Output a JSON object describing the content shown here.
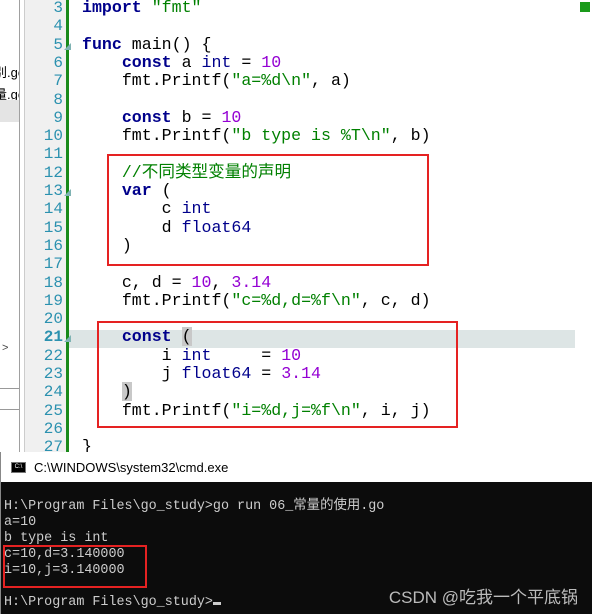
{
  "sidebar": {
    "files": [
      "别.go",
      "量.go"
    ]
  },
  "editor": {
    "current_line": 21,
    "lines": [
      {
        "n": 3,
        "tokens": [
          [
            "kw",
            "import"
          ],
          [
            "",
            ""
          ],
          [
            "str",
            " \"fmt\""
          ]
        ]
      },
      {
        "n": 4,
        "tokens": []
      },
      {
        "n": 5,
        "fold": true,
        "tokens": [
          [
            "kw",
            "func"
          ],
          [
            "",
            " main() {"
          ]
        ]
      },
      {
        "n": 6,
        "tokens": [
          [
            "",
            "    "
          ],
          [
            "kw",
            "const"
          ],
          [
            "",
            " a "
          ],
          [
            "ty",
            "int"
          ],
          [
            "",
            " = "
          ],
          [
            "num",
            "10"
          ]
        ]
      },
      {
        "n": 7,
        "tokens": [
          [
            "",
            "    fmt.Printf("
          ],
          [
            "str",
            "\"a=%d\\n\""
          ],
          [
            "",
            ", a)"
          ]
        ]
      },
      {
        "n": 8,
        "tokens": []
      },
      {
        "n": 9,
        "tokens": [
          [
            "",
            "    "
          ],
          [
            "kw",
            "const"
          ],
          [
            "",
            " b = "
          ],
          [
            "num",
            "10"
          ]
        ]
      },
      {
        "n": 10,
        "tokens": [
          [
            "",
            "    fmt.Printf("
          ],
          [
            "str",
            "\"b type is %T\\n\""
          ],
          [
            "",
            ", b)"
          ]
        ]
      },
      {
        "n": 11,
        "tokens": []
      },
      {
        "n": 12,
        "tokens": [
          [
            "",
            "    "
          ],
          [
            "cmt",
            "//不同类型变量的声明"
          ]
        ]
      },
      {
        "n": 13,
        "fold": true,
        "tokens": [
          [
            "",
            "    "
          ],
          [
            "kw",
            "var"
          ],
          [
            "",
            " ("
          ]
        ]
      },
      {
        "n": 14,
        "tokens": [
          [
            "",
            "        c "
          ],
          [
            "ty",
            "int"
          ]
        ]
      },
      {
        "n": 15,
        "tokens": [
          [
            "",
            "        d "
          ],
          [
            "ty",
            "float64"
          ]
        ]
      },
      {
        "n": 16,
        "tokens": [
          [
            "",
            "    )"
          ]
        ]
      },
      {
        "n": 17,
        "tokens": []
      },
      {
        "n": 18,
        "tokens": [
          [
            "",
            "    c, d = "
          ],
          [
            "num",
            "10"
          ],
          [
            "",
            ", "
          ],
          [
            "num",
            "3.14"
          ]
        ]
      },
      {
        "n": 19,
        "tokens": [
          [
            "",
            "    fmt.Printf("
          ],
          [
            "str",
            "\"c=%d,d=%f\\n\""
          ],
          [
            "",
            ", c, d)"
          ]
        ]
      },
      {
        "n": 20,
        "tokens": []
      },
      {
        "n": 21,
        "fold": true,
        "tokens": [
          [
            "",
            "    "
          ],
          [
            "kw",
            "const"
          ],
          [
            "",
            " "
          ],
          [
            "br",
            "("
          ]
        ]
      },
      {
        "n": 22,
        "tokens": [
          [
            "",
            "        i "
          ],
          [
            "ty",
            "int"
          ],
          [
            "",
            "     = "
          ],
          [
            "num",
            "10"
          ]
        ]
      },
      {
        "n": 23,
        "tokens": [
          [
            "",
            "        j "
          ],
          [
            "ty",
            "float64"
          ],
          [
            "",
            " = "
          ],
          [
            "num",
            "3.14"
          ]
        ]
      },
      {
        "n": 24,
        "tokens": [
          [
            "",
            "    "
          ],
          [
            "br",
            ")"
          ]
        ]
      },
      {
        "n": 25,
        "tokens": [
          [
            "",
            "    fmt.Printf("
          ],
          [
            "str",
            "\"i=%d,j=%f\\n\""
          ],
          [
            "",
            ", i, j)"
          ]
        ]
      },
      {
        "n": 26,
        "tokens": []
      },
      {
        "n": 27,
        "tokens": [
          [
            "",
            "}"
          ]
        ]
      }
    ]
  },
  "terminal": {
    "title": "C:\\WINDOWS\\system32\\cmd.exe",
    "icon": "C:\\",
    "lines": [
      "H:\\Program Files\\go_study>go run 06_常量的使用.go",
      "a=10",
      "b type is int",
      "c=10,d=3.140000",
      "i=10,j=3.140000",
      "",
      "H:\\Program Files\\go_study>"
    ]
  },
  "watermark": "CSDN @吃我一个平底锅",
  "colors": {
    "highlight_box": "#e52222",
    "keyword": "#00008b",
    "string": "#008000",
    "number": "#9400d3",
    "line_number": "#2b91af"
  }
}
